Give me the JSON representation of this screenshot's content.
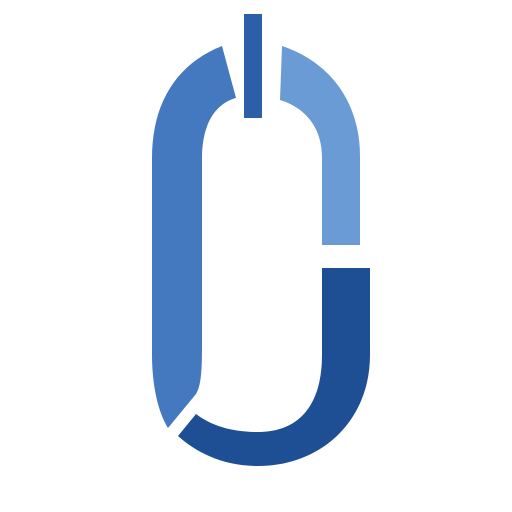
{
  "logo": {
    "icon": "stylized-power-link-logo-icon",
    "colors": {
      "background": "#ffffff",
      "left_arc": "#4478bf",
      "top_right_arc": "#6a9bd4",
      "bottom_arc": "#1e4f94",
      "center_bar": "#2b5fa8"
    }
  }
}
